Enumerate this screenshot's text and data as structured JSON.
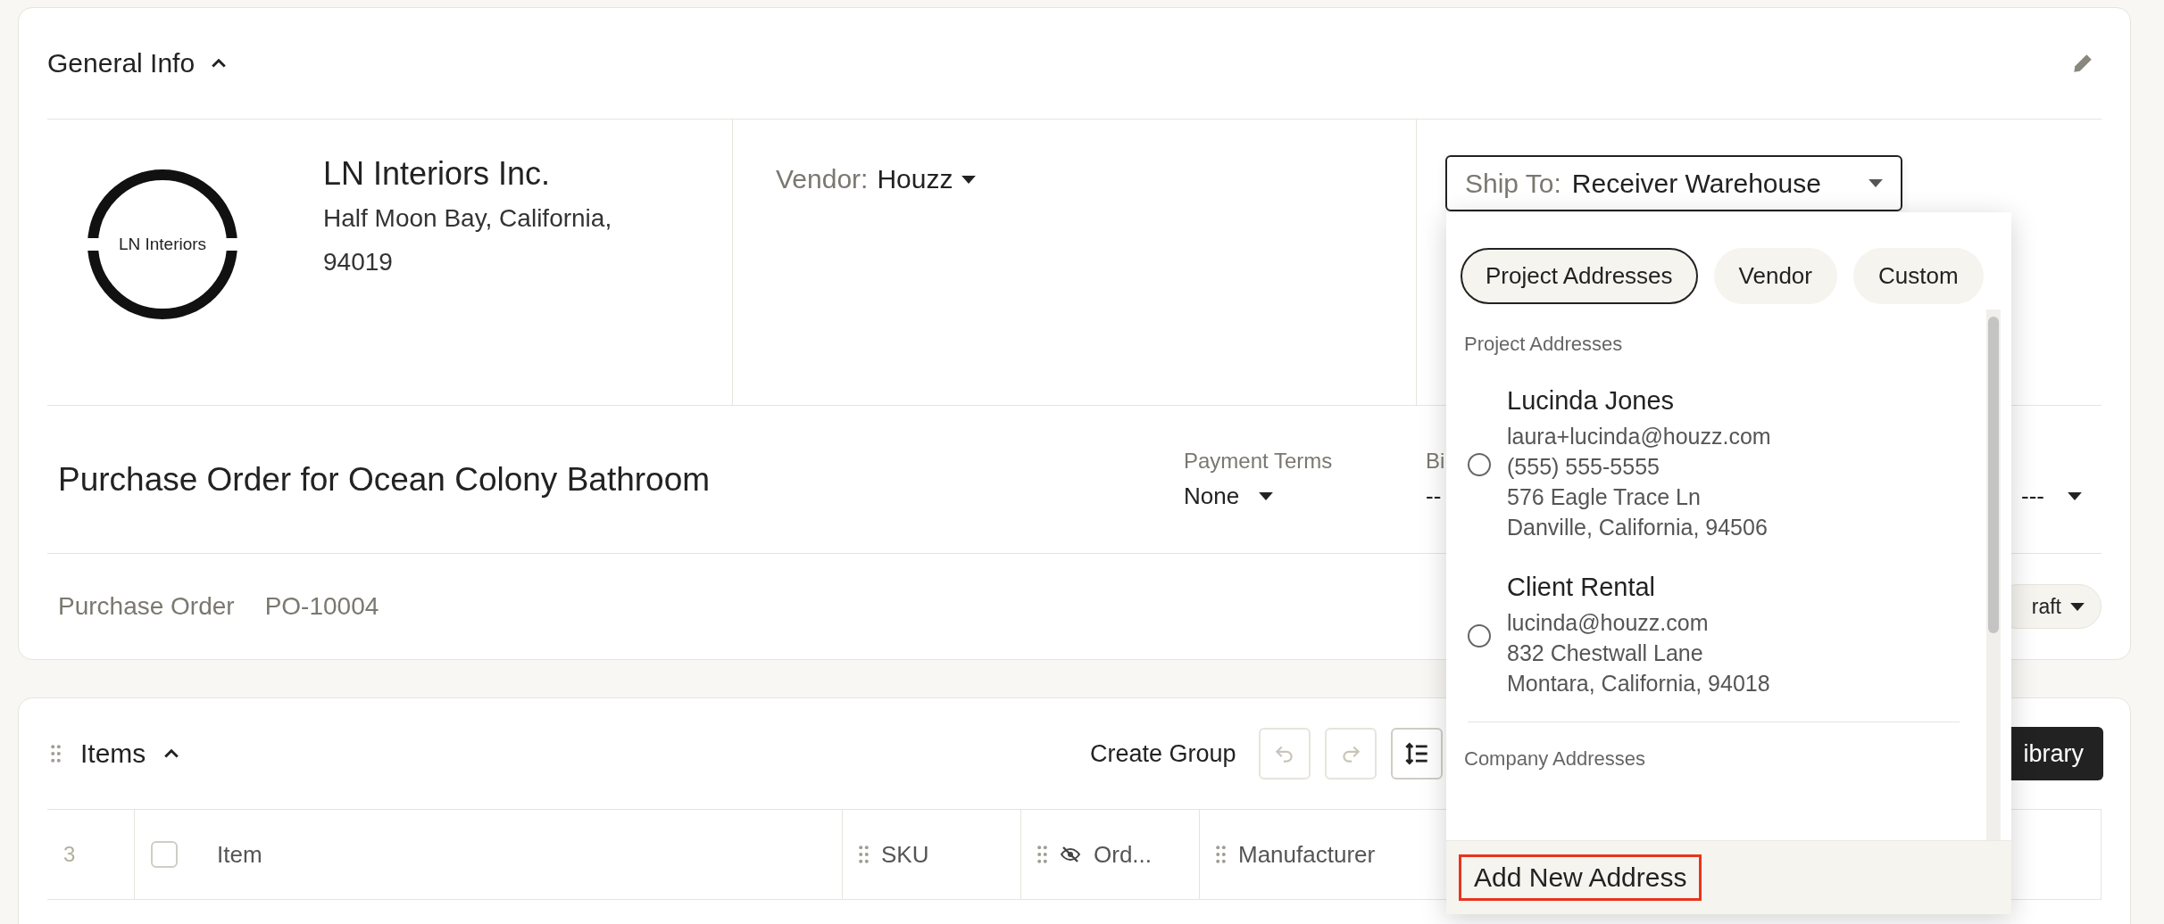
{
  "general_info": {
    "title": "General Info",
    "expanded": true
  },
  "company": {
    "logo_text": "LN Interiors",
    "name": "LN Interiors Inc.",
    "address": "Half Moon Bay, California, 94019"
  },
  "vendor": {
    "label": "Vendor:",
    "value": "Houzz"
  },
  "ship_to": {
    "label": "Ship To:",
    "value": "Receiver Warehouse",
    "open": true
  },
  "address_menu": {
    "tabs": [
      {
        "label": "Project Addresses",
        "selected": true
      },
      {
        "label": "Vendor",
        "selected": false
      },
      {
        "label": "Custom",
        "selected": false
      }
    ],
    "sections": [
      {
        "title": "Project Addresses",
        "addresses": [
          {
            "name": "Lucinda Jones",
            "lines": [
              "laura+lucinda@houzz.com",
              "(555) 555-5555",
              "576 Eagle Trace Ln",
              "Danville, California, 94506"
            ],
            "selected": false
          },
          {
            "name": "Client Rental",
            "lines": [
              "lucinda@houzz.com",
              "832 Chestwall Lane",
              "Montara, California, 94018"
            ],
            "selected": false
          }
        ]
      },
      {
        "title": "Company Addresses"
      }
    ],
    "add_button": {
      "label": "Add New Address",
      "highlighted": true
    }
  },
  "purchase_order": {
    "title": "Purchase Order for Ocean Colony Bathroom",
    "fields": [
      {
        "label": "Payment Terms",
        "value": "None"
      },
      {
        "label": "Bi",
        "value": "--"
      }
    ],
    "field_3_value": "---",
    "type_label": "Purchase Order",
    "number": "PO-10004",
    "status": "raft"
  },
  "items": {
    "title": "Items",
    "expanded": true,
    "create_group": "Create Group",
    "toolbar_buttons": [
      {
        "kind": "undo",
        "disabled": true
      },
      {
        "kind": "redo",
        "disabled": true
      },
      {
        "kind": "row-height",
        "disabled": false
      }
    ],
    "library_button": "ibrary",
    "row_count": "3",
    "select_all_checked": false,
    "columns": [
      {
        "label": "Item",
        "hidden": false
      },
      {
        "label": "SKU",
        "hidden": false
      },
      {
        "label": "Ord...",
        "hidden": true
      },
      {
        "label": "Manufacturer",
        "hidden": false
      }
    ]
  }
}
